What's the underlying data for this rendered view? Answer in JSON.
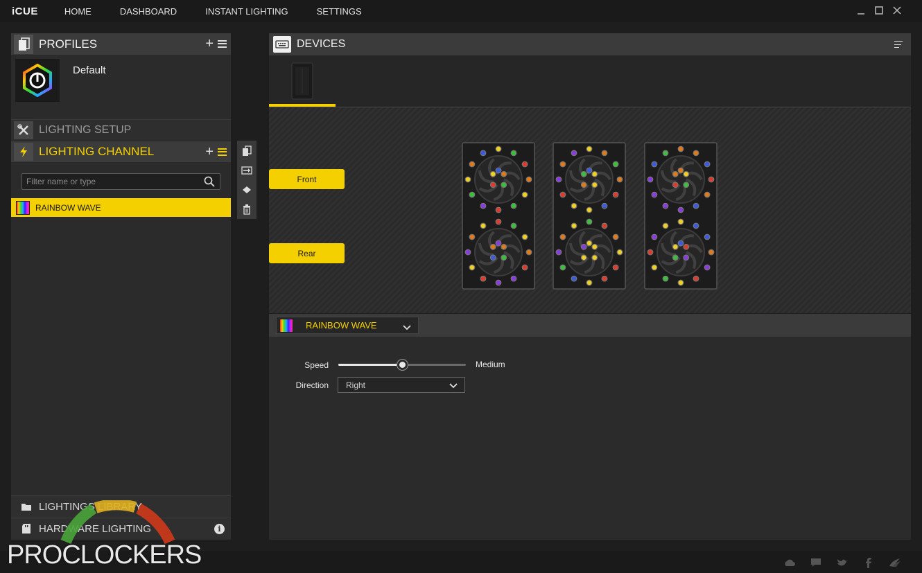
{
  "app": {
    "title": "iCUE"
  },
  "nav": [
    "HOME",
    "DASHBOARD",
    "INSTANT LIGHTING",
    "SETTINGS"
  ],
  "window_controls": [
    "minimize-icon",
    "maximize-icon",
    "close-icon"
  ],
  "profiles": {
    "title": "PROFILES",
    "items": [
      {
        "name": "Default",
        "icon": "icue-logo-icon"
      }
    ]
  },
  "lighting_setup": {
    "title": "LIGHTING SETUP"
  },
  "lighting_channel": {
    "title": "LIGHTING CHANNEL",
    "filter_placeholder": "Filter name or type",
    "effects": [
      {
        "label": "RAINBOW WAVE"
      }
    ]
  },
  "side_toolbar": [
    "copy-icon",
    "import-icon",
    "move-icon",
    "delete-icon"
  ],
  "library": {
    "lightings_library": "LIGHTINGS LIBRARY",
    "hardware_lighting": "HARDWARE LIGHTING"
  },
  "devices": {
    "title": "DEVICES"
  },
  "zones": {
    "front": "Front",
    "rear": "Rear"
  },
  "effect_bar": {
    "selected": "RAINBOW WAVE"
  },
  "properties": {
    "speed_label": "Speed",
    "speed_value": "Medium",
    "speed_fraction": 0.5,
    "direction_label": "Direction",
    "direction_value": "Right"
  },
  "bottom_icons": [
    "cloud-icon",
    "chat-icon",
    "twitter-icon",
    "facebook-icon",
    "corsair-icon"
  ],
  "watermark": {
    "text": "PROCLOCKERS"
  },
  "colors": {
    "accent": "#f5d000",
    "panel": "#2b2b2b",
    "header": "#3b3b3b",
    "led": [
      "#e03a2a",
      "#e07a1a",
      "#f0d020",
      "#3ac03a",
      "#3a5ae0",
      "#8a3ae0"
    ]
  }
}
